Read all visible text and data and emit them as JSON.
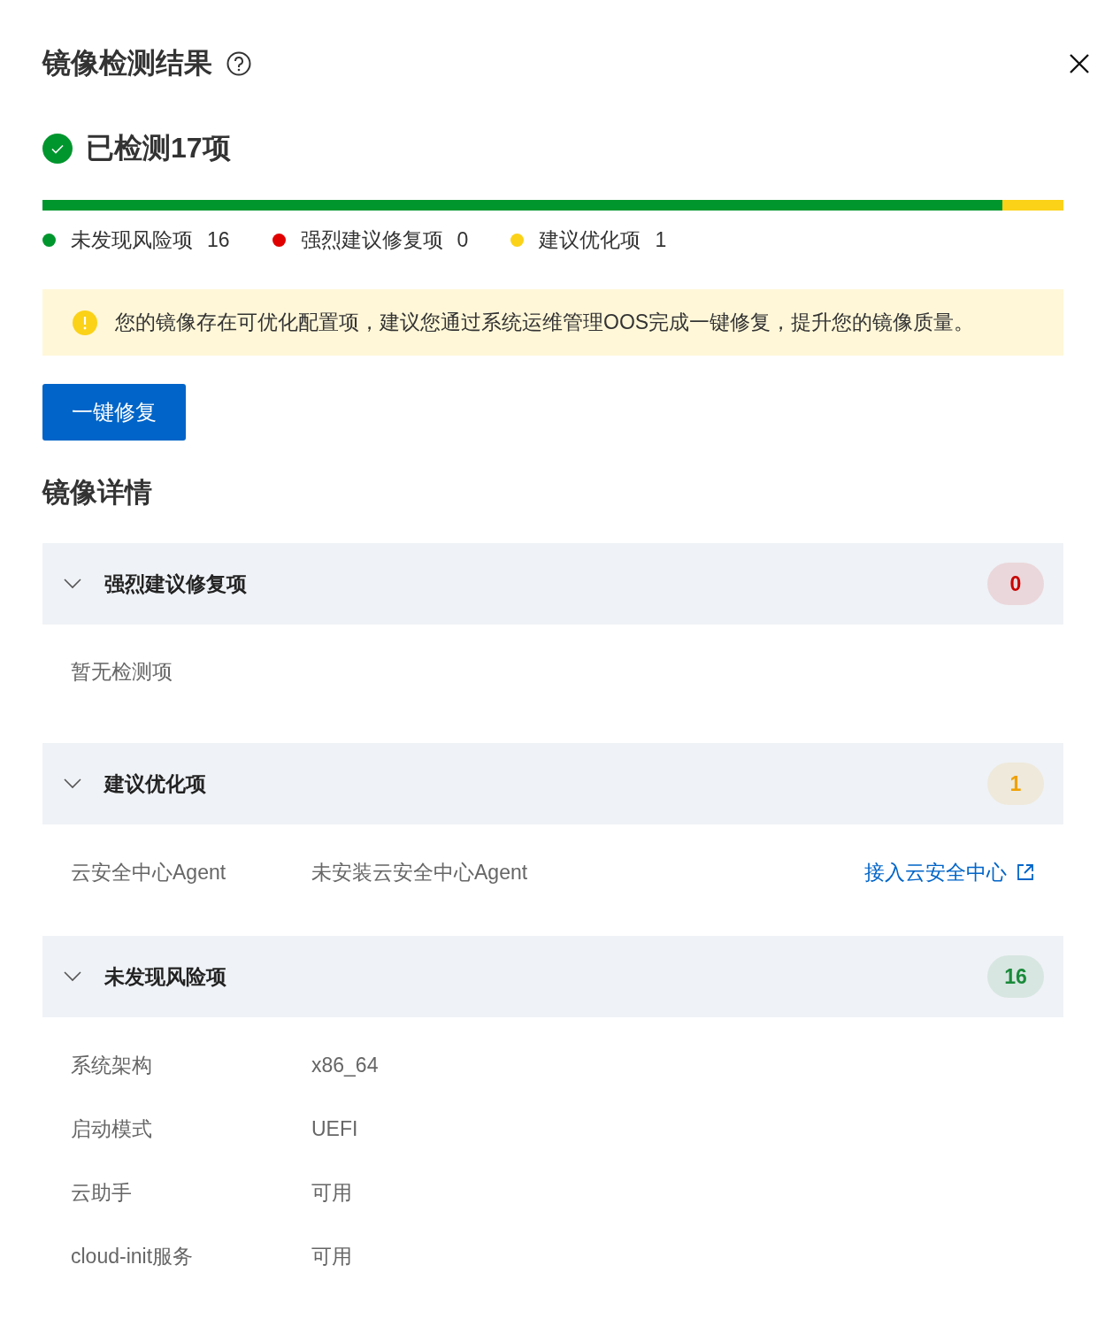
{
  "title": "镜像检测结果",
  "summary": {
    "text": "已检测17项",
    "checked": true
  },
  "legend": [
    {
      "label": "未发现风险项",
      "count": "16",
      "color": "#00962e",
      "level": 0.94
    },
    {
      "label": "强烈建议修复项",
      "count": "0",
      "color": "#e10000",
      "level": 0
    },
    {
      "label": "建议优化项",
      "count": "1",
      "color": "#fbd218",
      "level": 0.06
    }
  ],
  "alert": {
    "text": "您的镜像存在可优化配置项，建议您通过系统运维管理OOS完成一键修复，提升您的镜像质量。"
  },
  "fix_button": "一键修复",
  "details_title": "镜像详情",
  "sections": [
    {
      "title": "强烈建议修复项",
      "count": "0",
      "color": "#c80000",
      "expanded": true,
      "empty_text": "暂无检测项"
    },
    {
      "title": "建议优化项",
      "count": "1",
      "color": "#f0a000",
      "expanded": true,
      "rows": [
        {
          "label": "云安全中心Agent",
          "value": "未安装云安全中心Agent",
          "link": "接入云安全中心"
        }
      ]
    },
    {
      "title": "未发现风险项",
      "count": "16",
      "color": "#1a8a3a",
      "expanded": true,
      "rows": [
        {
          "label": "系统架构",
          "value": "x86_64"
        },
        {
          "label": "启动模式",
          "value": "UEFI"
        },
        {
          "label": "云助手",
          "value": "可用"
        },
        {
          "label": "cloud-init服务",
          "value": "可用"
        }
      ]
    }
  ]
}
